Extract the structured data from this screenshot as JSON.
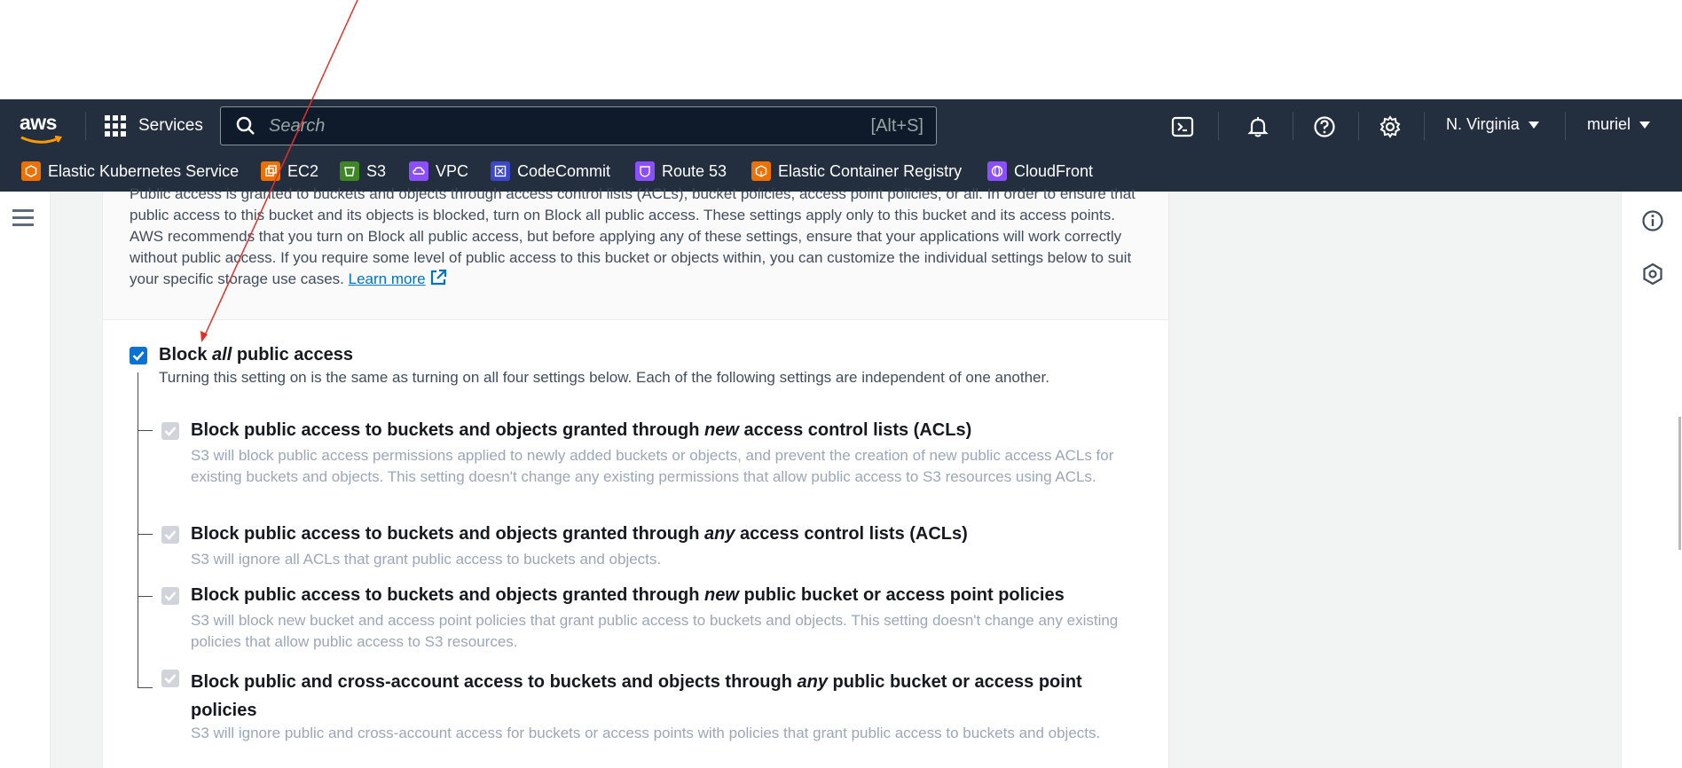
{
  "nav": {
    "services_label": "Services",
    "search_placeholder": "Search",
    "search_shortcut": "[Alt+S]",
    "region": "N. Virginia",
    "user": "muriel"
  },
  "favorites": [
    {
      "label": "Elastic Kubernetes Service",
      "color": "#ed7100"
    },
    {
      "label": "EC2",
      "color": "#ed7100"
    },
    {
      "label": "S3",
      "color": "#3f8624"
    },
    {
      "label": "VPC",
      "color": "#8c4fff"
    },
    {
      "label": "CodeCommit",
      "color": "#3b48cc"
    },
    {
      "label": "Route 53",
      "color": "#8c4fff"
    },
    {
      "label": "Elastic Container Registry",
      "color": "#ed7100"
    },
    {
      "label": "CloudFront",
      "color": "#8c4fff"
    }
  ],
  "section": {
    "description": "Public access is granted to buckets and objects through access control lists (ACLs), bucket policies, access point policies, or all. In order to ensure that public access to this bucket and its objects is blocked, turn on Block all public access. These settings apply only to this bucket and its access points. AWS recommends that you turn on Block all public access, but before applying any of these settings, ensure that your applications will work correctly without public access. If you require some level of public access to this bucket or objects within, you can customize the individual settings below to suit your specific storage use cases.",
    "learn_more": "Learn more"
  },
  "block_all": {
    "label_pre": "Block ",
    "label_em": "all",
    "label_post": " public access",
    "checked": true,
    "description": "Turning this setting on is the same as turning on all four settings below. Each of the following settings are independent of one another."
  },
  "settings": [
    {
      "label_pre": "Block public access to buckets and objects granted through ",
      "label_em": "new",
      "label_post": " access control lists (ACLs)",
      "description": "S3 will block public access permissions applied to newly added buckets or objects, and prevent the creation of new public access ACLs for existing buckets and objects. This setting doesn't change any existing permissions that allow public access to S3 resources using ACLs.",
      "checked": true
    },
    {
      "label_pre": "Block public access to buckets and objects granted through ",
      "label_em": "any",
      "label_post": " access control lists (ACLs)",
      "description": "S3 will ignore all ACLs that grant public access to buckets and objects.",
      "checked": true
    },
    {
      "label_pre": "Block public access to buckets and objects granted through ",
      "label_em": "new",
      "label_post": " public bucket or access point policies",
      "description": "S3 will block new bucket and access point policies that grant public access to buckets and objects. This setting doesn't change any existing policies that allow public access to S3 resources.",
      "checked": true
    },
    {
      "label_pre": "Block public and cross-account access to buckets and objects through ",
      "label_em": "any",
      "label_post": " public bucket or access point policies",
      "description": "S3 will ignore public and cross-account access for buckets or access points with policies that grant public access to buckets and objects.",
      "checked": true
    }
  ]
}
